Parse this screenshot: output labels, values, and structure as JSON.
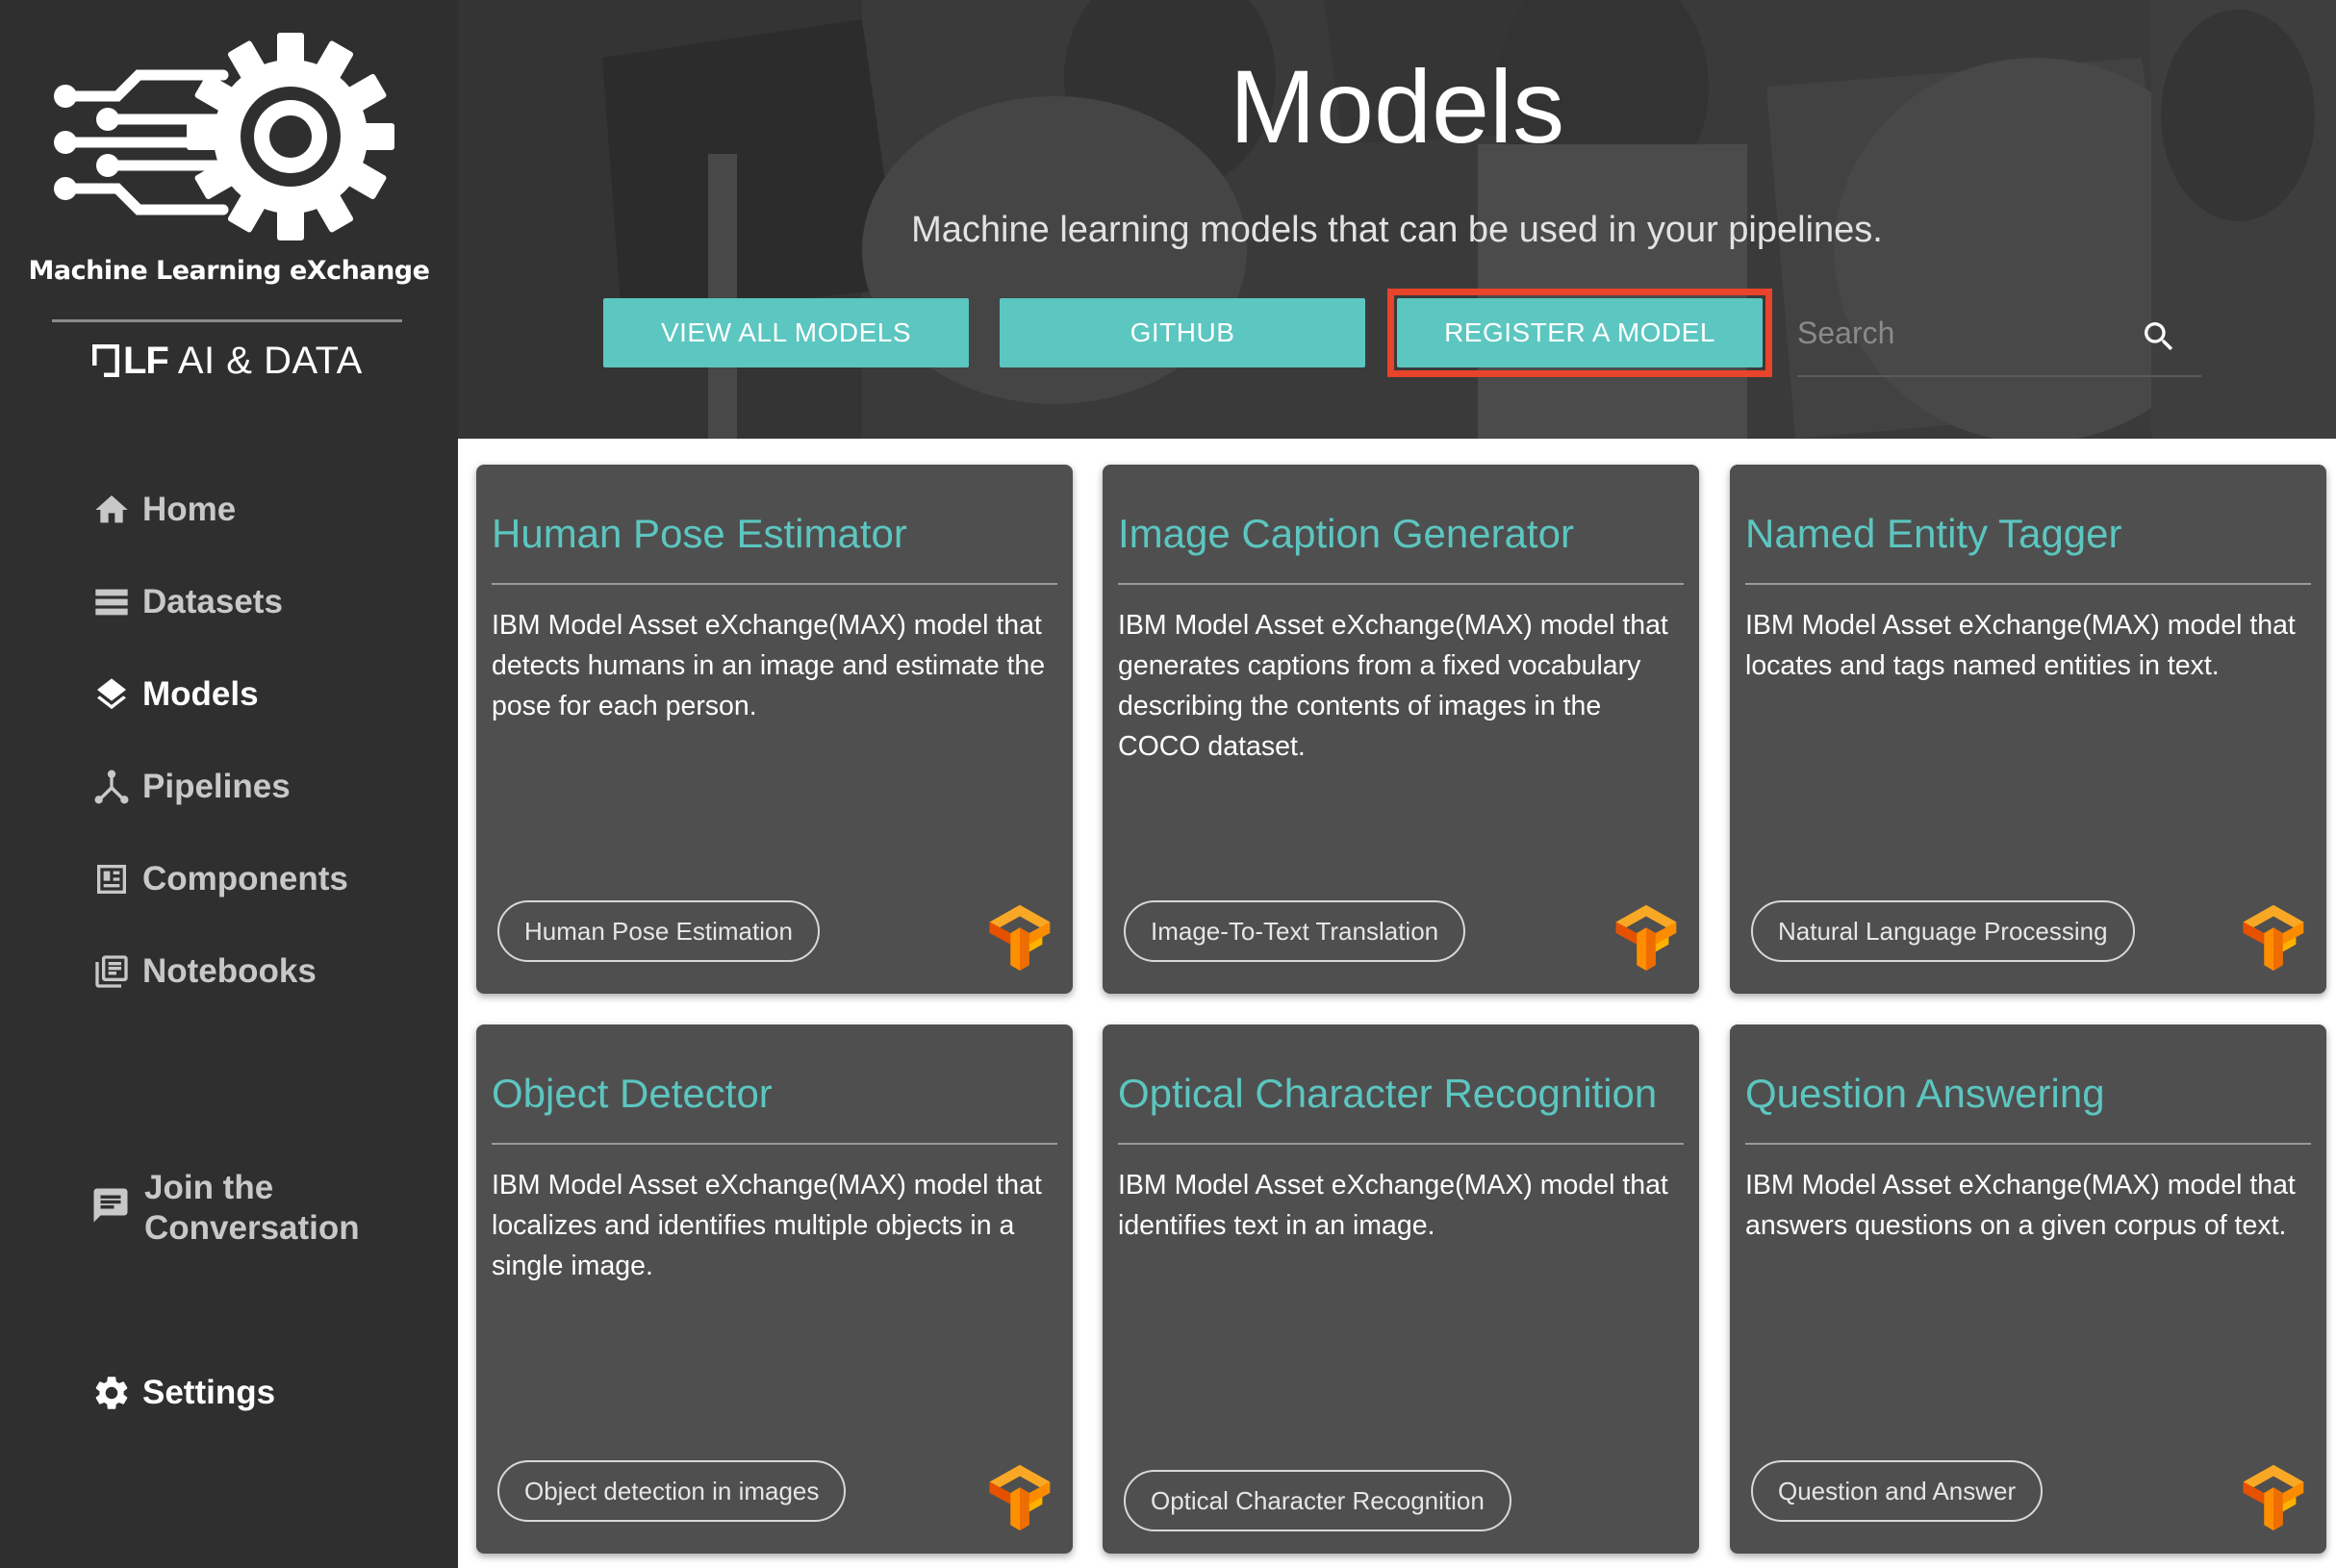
{
  "sidebar": {
    "brand": "Machine Learning eXchange",
    "partner_logo": {
      "mark": "LF",
      "text": "AI & DATA"
    },
    "nav": [
      {
        "label": "Home",
        "icon": "home-icon",
        "active": false
      },
      {
        "label": "Datasets",
        "icon": "datasets-icon",
        "active": false
      },
      {
        "label": "Models",
        "icon": "layers-icon",
        "active": true
      },
      {
        "label": "Pipelines",
        "icon": "pipeline-icon",
        "active": false
      },
      {
        "label": "Components",
        "icon": "components-icon",
        "active": false
      },
      {
        "label": "Notebooks",
        "icon": "notebook-icon",
        "active": false
      }
    ],
    "join": "Join the Conversation",
    "settings": "Settings"
  },
  "header": {
    "title": "Models",
    "subtitle": "Machine learning models that can be used in your pipelines.",
    "buttons": {
      "view_all": "VIEW ALL MODELS",
      "github": "GITHUB",
      "register": "REGISTER A MODEL"
    },
    "search": {
      "placeholder": "Search",
      "value": ""
    },
    "highlight_color": "#e8432b",
    "accent_color": "#5cc6c0"
  },
  "cards": [
    {
      "title": "Human Pose Estimator",
      "description": "IBM Model Asset eXchange(MAX) model that detects humans in an image and estimate the pose for each person.",
      "tag": "Human Pose Estimation",
      "framework_icon": "tensorflow-icon"
    },
    {
      "title": "Image Caption Generator",
      "description": "IBM Model Asset eXchange(MAX) model that generates captions from a fixed vocabulary describing the contents of images in the COCO dataset.",
      "tag": "Image-To-Text Translation",
      "framework_icon": "tensorflow-icon"
    },
    {
      "title": "Named Entity Tagger",
      "description": "IBM Model Asset eXchange(MAX) model that locates and tags named entities in text.",
      "tag": "Natural Language Processing",
      "framework_icon": "tensorflow-icon"
    },
    {
      "title": "Object Detector",
      "description": "IBM Model Asset eXchange(MAX) model that localizes and identifies multiple objects in a single image.",
      "tag": "Object detection in images",
      "framework_icon": "tensorflow-icon"
    },
    {
      "title": "Optical Character Recognition",
      "description": "IBM Model Asset eXchange(MAX) model that identifies text in an image.",
      "tag": "Optical Character Recognition",
      "framework_icon": "none"
    },
    {
      "title": "Question Answering",
      "description": "IBM Model Asset eXchange(MAX) model that answers questions on a given corpus of text.",
      "tag": "Question and Answer",
      "framework_icon": "tensorflow-icon"
    }
  ]
}
